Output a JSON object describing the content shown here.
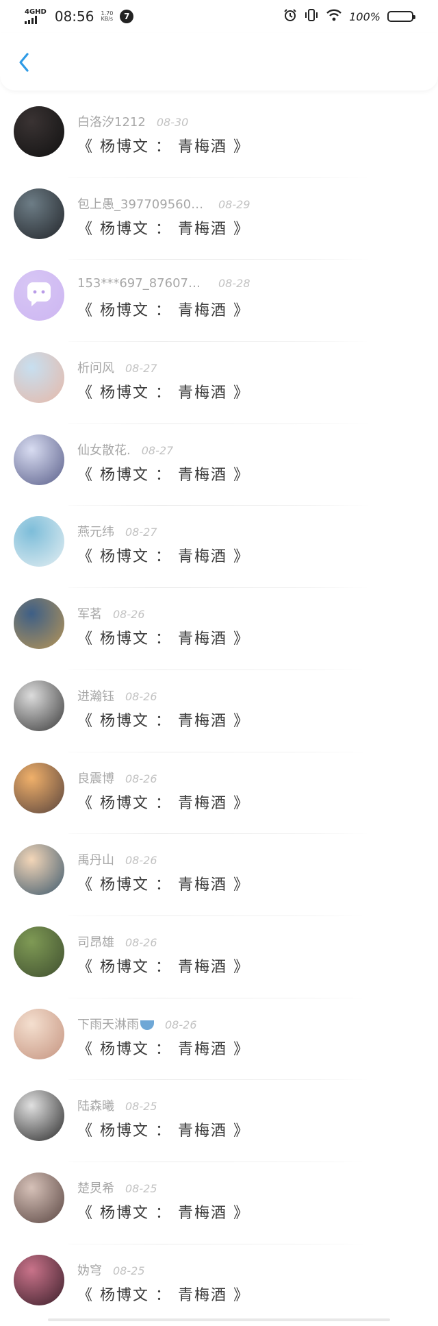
{
  "status_bar": {
    "network": "4GHD",
    "time": "08:56",
    "speed_value": "1.70",
    "speed_unit": "KB/s",
    "notification_count": "7",
    "battery": "100%"
  },
  "header": {
    "back_icon": "chevron-left-icon",
    "accent": "#2f9be6"
  },
  "comments": [
    {
      "name": "白洛汐1212",
      "date": "08-30",
      "title": "《 杨博文 ： 青梅酒 》",
      "avatar_colors": [
        "#3a3333",
        "#111111"
      ]
    },
    {
      "name": "包上愚_3977095606...",
      "date": "08-29",
      "title": "《 杨博文 ： 青梅酒 》",
      "avatar_colors": [
        "#6d7d86",
        "#23262b"
      ]
    },
    {
      "name": "153***697_8760743...",
      "date": "08-28",
      "title": "《 杨博文 ： 青梅酒 》",
      "avatar_colors": [
        "#d7c6f4",
        "#cdb6f2"
      ]
    },
    {
      "name": "析问风",
      "date": "08-27",
      "title": "《 杨博文 ： 青梅酒 》",
      "avatar_colors": [
        "#c7dff0",
        "#e6b8a8"
      ]
    },
    {
      "name": "仙女散花.",
      "date": "08-27",
      "title": "《 杨博文 ： 青梅酒 》",
      "avatar_colors": [
        "#d8dcf1",
        "#5a5f8a"
      ]
    },
    {
      "name": "燕元纬",
      "date": "08-27",
      "title": "《 杨博文 ： 青梅酒 》",
      "avatar_colors": [
        "#7dbdd9",
        "#e3eef2"
      ]
    },
    {
      "name": "军茗",
      "date": "08-26",
      "title": "《 杨博文 ： 青梅酒 》",
      "avatar_colors": [
        "#3e5f86",
        "#b79556"
      ]
    },
    {
      "name": "进瀚钰",
      "date": "08-26",
      "title": "《 杨博文 ： 青梅酒 》",
      "avatar_colors": [
        "#dcdcdc",
        "#3b3b3b"
      ]
    },
    {
      "name": "良震博",
      "date": "08-26",
      "title": "《 杨博文 ： 青梅酒 》",
      "avatar_colors": [
        "#f0b06a",
        "#58433c"
      ]
    },
    {
      "name": "禹丹山",
      "date": "08-26",
      "title": "《 杨博文 ： 青梅酒 》",
      "avatar_colors": [
        "#f3d6b8",
        "#3e5a6e"
      ]
    },
    {
      "name": "司昂雄",
      "date": "08-26",
      "title": "《 杨博文 ： 青梅酒 》",
      "avatar_colors": [
        "#7f9a55",
        "#3f4f2f"
      ]
    },
    {
      "name": "下雨天淋雨",
      "date": "08-26",
      "title": "《 杨博文 ： 青梅酒 》",
      "avatar_colors": [
        "#f4dfcf",
        "#c59480"
      ]
    },
    {
      "name": "陆森曦",
      "date": "08-25",
      "title": "《 杨博文 ： 青梅酒 》",
      "avatar_colors": [
        "#e0e0e0",
        "#2c2c2c"
      ]
    },
    {
      "name": "楚炅希",
      "date": "08-25",
      "title": "《 杨博文 ： 青梅酒 》",
      "avatar_colors": [
        "#d6c1b8",
        "#5a4642"
      ]
    },
    {
      "name": "妫穹",
      "date": "08-25",
      "title": "《 杨博文 ： 青梅酒 》",
      "avatar_colors": [
        "#c9738a",
        "#3b1f2a"
      ]
    }
  ]
}
